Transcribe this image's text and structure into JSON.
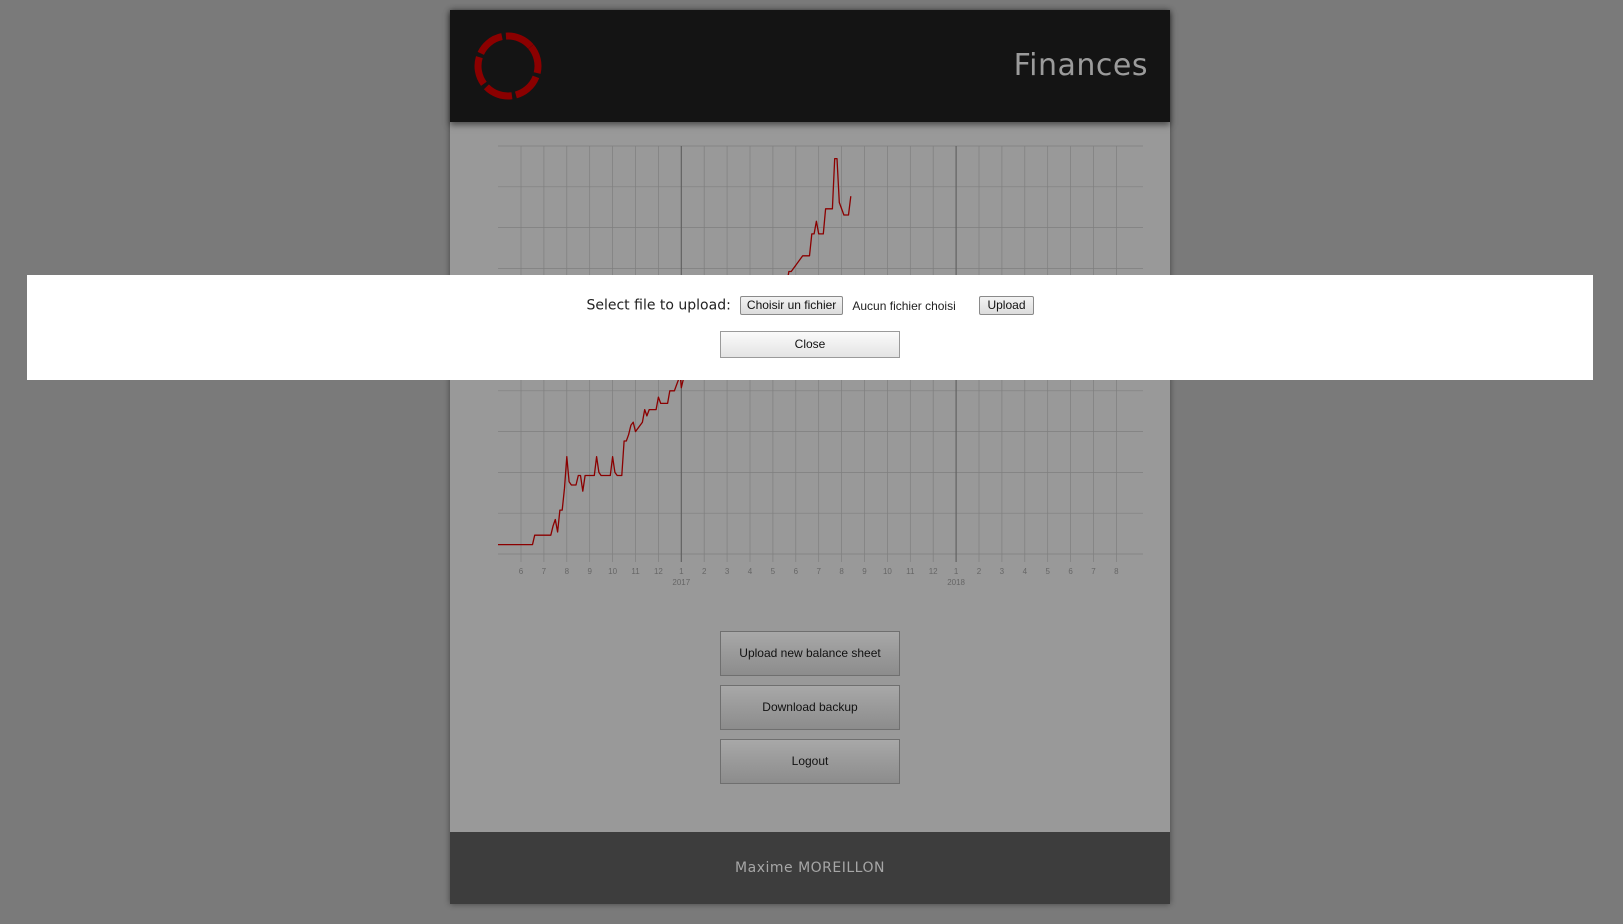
{
  "header": {
    "title": "Finances",
    "logo_icon": "ring-logo-icon"
  },
  "colors": {
    "background": "#7a7a7a",
    "card": "#999999",
    "header": "#141414",
    "footer": "#3d3d3d",
    "accent": "#8b0000"
  },
  "chart_data": {
    "type": "line",
    "x_ticks": [
      "6",
      "7",
      "8",
      "9",
      "10",
      "11",
      "12",
      "1",
      "2",
      "3",
      "4",
      "5",
      "6",
      "7",
      "8",
      "9",
      "10",
      "11",
      "12",
      "1",
      "2",
      "3",
      "4",
      "5",
      "6",
      "7",
      "8"
    ],
    "year_labels": [
      {
        "label": "2017",
        "tick_index": 7
      },
      {
        "label": "2018",
        "tick_index": 19
      }
    ],
    "grid": true,
    "series": [
      {
        "values": [
          [
            0,
            3
          ],
          [
            0.5,
            3
          ],
          [
            0.6,
            6
          ],
          [
            1.3,
            6
          ],
          [
            1.4,
            9
          ],
          [
            1.5,
            11
          ],
          [
            1.6,
            7
          ],
          [
            1.7,
            14
          ],
          [
            1.8,
            14
          ],
          [
            1.9,
            21
          ],
          [
            2.0,
            31
          ],
          [
            2.1,
            23
          ],
          [
            2.2,
            22
          ],
          [
            2.4,
            22
          ],
          [
            2.5,
            25
          ],
          [
            2.6,
            25
          ],
          [
            2.7,
            20
          ],
          [
            2.8,
            25
          ],
          [
            3.2,
            25
          ],
          [
            3.3,
            31
          ],
          [
            3.4,
            26
          ],
          [
            3.5,
            25
          ],
          [
            3.9,
            25
          ],
          [
            4.0,
            31
          ],
          [
            4.1,
            26
          ],
          [
            4.2,
            25
          ],
          [
            4.4,
            25
          ],
          [
            4.5,
            36
          ],
          [
            4.6,
            36
          ],
          [
            4.7,
            38
          ],
          [
            4.8,
            41
          ],
          [
            4.9,
            42
          ],
          [
            5.0,
            39
          ],
          [
            5.3,
            42
          ],
          [
            5.4,
            46
          ],
          [
            5.5,
            44
          ],
          [
            5.6,
            46
          ],
          [
            5.9,
            46
          ],
          [
            6.0,
            50
          ],
          [
            6.1,
            48
          ],
          [
            6.4,
            48
          ],
          [
            6.5,
            52
          ],
          [
            6.7,
            52
          ],
          [
            6.8,
            54
          ],
          [
            6.95,
            57
          ],
          [
            7.0,
            53
          ],
          [
            7.1,
            56
          ],
          [
            9.5,
            70
          ],
          [
            9.7,
            82
          ],
          [
            9.8,
            84
          ],
          [
            9.9,
            80
          ],
          [
            10.3,
            82
          ],
          [
            10.4,
            84
          ],
          [
            10.5,
            82
          ],
          [
            10.8,
            86
          ],
          [
            11.6,
            86
          ],
          [
            11.7,
            90
          ],
          [
            11.8,
            90
          ],
          [
            11.9,
            91
          ],
          [
            12.3,
            95
          ],
          [
            12.6,
            95
          ],
          [
            12.7,
            102
          ],
          [
            12.8,
            102
          ],
          [
            12.9,
            106
          ],
          [
            13.0,
            102
          ],
          [
            13.2,
            102
          ],
          [
            13.3,
            110
          ],
          [
            13.6,
            110
          ],
          [
            13.7,
            126
          ],
          [
            13.8,
            126
          ],
          [
            13.9,
            112
          ],
          [
            14.1,
            108
          ],
          [
            14.3,
            108
          ],
          [
            14.4,
            114
          ]
        ]
      }
    ]
  },
  "buttons": {
    "upload": "Upload new balance sheet",
    "download": "Download backup",
    "logout": "Logout"
  },
  "footer": {
    "author": "Maxime MOREILLON"
  },
  "modal": {
    "label": "Select file to upload:",
    "choose_file": "Choisir un fichier",
    "no_file": "Aucun fichier choisi",
    "upload": "Upload",
    "close": "Close"
  }
}
